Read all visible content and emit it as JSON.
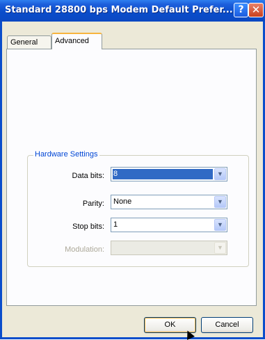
{
  "window": {
    "title": "Standard 28800 bps Modem Default Prefer...",
    "help_glyph": "?",
    "close_glyph": "✕"
  },
  "tabs": [
    {
      "label": "General",
      "active": false
    },
    {
      "label": "Advanced",
      "active": true
    }
  ],
  "hardware_settings": {
    "legend": "Hardware Settings",
    "fields": [
      {
        "label": "Data bits:",
        "value": "8",
        "selected": true,
        "enabled": true
      },
      {
        "label": "Parity:",
        "value": "None",
        "selected": false,
        "enabled": true
      },
      {
        "label": "Stop bits:",
        "value": "1",
        "selected": false,
        "enabled": true
      },
      {
        "label": "Modulation:",
        "value": "",
        "selected": false,
        "enabled": false
      }
    ]
  },
  "buttons": {
    "ok": "OK",
    "cancel": "Cancel"
  },
  "colors": {
    "title_bar": "#0A4DCB",
    "group_legend": "#0046D5",
    "selection": "#316AC5",
    "dialog_background": "#ECE9D8"
  }
}
